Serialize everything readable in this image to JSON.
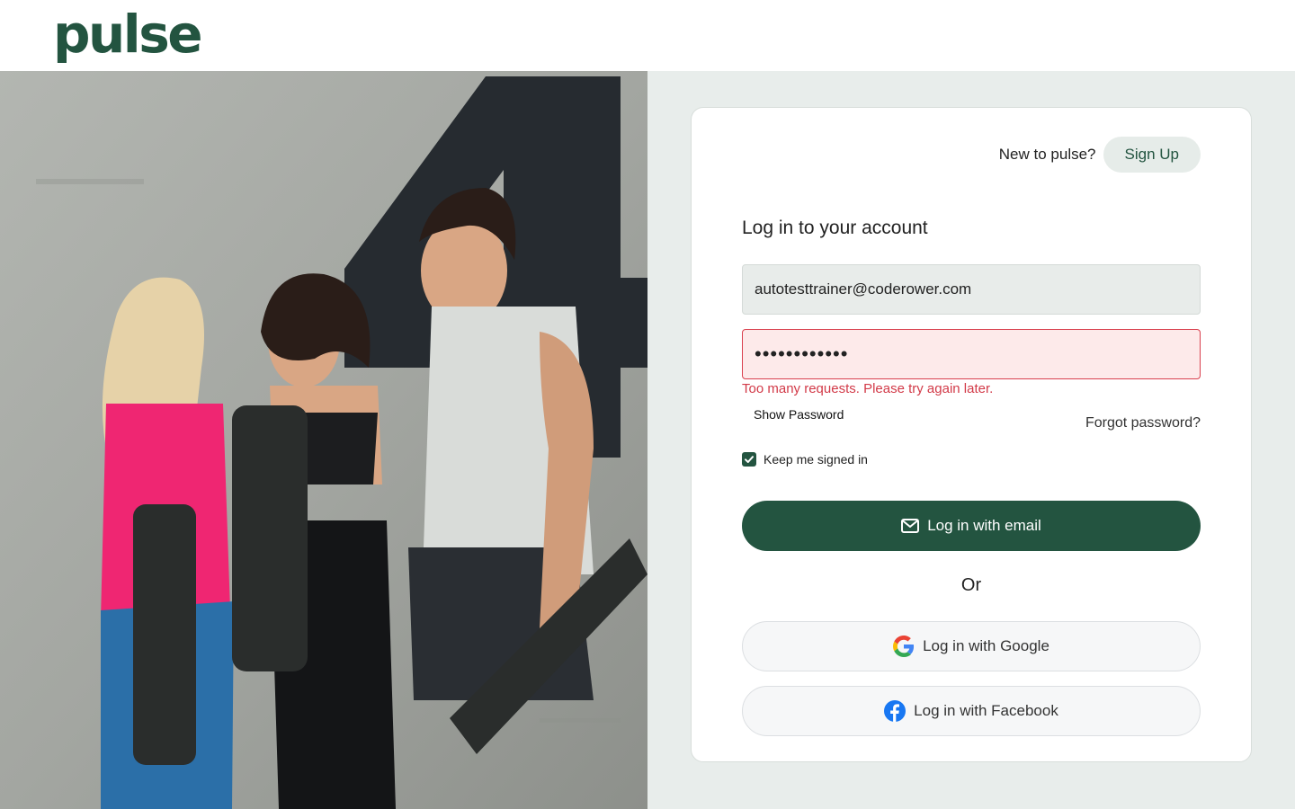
{
  "brand": {
    "logo_text": "pulse",
    "color": "#235440"
  },
  "hero": {
    "image_name": "fitness-group-photo",
    "wall_number": "4"
  },
  "signup": {
    "prompt": "New to pulse?",
    "button_label": "Sign Up"
  },
  "login_form": {
    "heading": "Log in to your account",
    "email_value": "autotesttrainer@coderower.com",
    "password_masked": "••••••••••••",
    "error_message": "Too many requests. Please try again later.",
    "show_password_label": "Show Password",
    "forgot_password_label": "Forgot password?",
    "keep_signed_in_label": "Keep me signed in",
    "keep_signed_in_checked": true,
    "email_login_label": "Log in with email",
    "divider_text": "Or",
    "google_login_label": "Log in with Google",
    "facebook_login_label": "Log in with Facebook"
  },
  "colors": {
    "accent": "#235440",
    "error": "#d23a48",
    "panel_background": "#e8edeb"
  }
}
